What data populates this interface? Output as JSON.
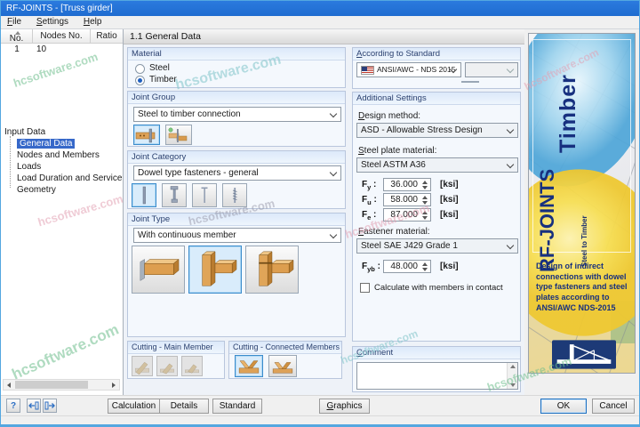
{
  "window": {
    "title": "RF-JOINTS - [Truss girder]"
  },
  "menu": {
    "items": [
      "File",
      "Settings",
      "Help"
    ]
  },
  "results_table": {
    "columns": [
      "No.",
      "Nodes No.",
      "Ratio"
    ],
    "rows": [
      {
        "no": "1",
        "nodes": "10",
        "ratio": ""
      }
    ]
  },
  "nav_tree": {
    "root": "Input Data",
    "items": [
      {
        "label": "General Data",
        "selected": true
      },
      {
        "label": "Nodes and Members",
        "selected": false
      },
      {
        "label": "Loads",
        "selected": false
      },
      {
        "label": "Load Duration and Service Con",
        "selected": false
      },
      {
        "label": "Geometry",
        "selected": false
      }
    ]
  },
  "section": {
    "title": "1.1 General Data"
  },
  "material": {
    "label": "Material",
    "steel": "Steel",
    "timber": "Timber",
    "selected": "Timber"
  },
  "joint_group": {
    "label": "Joint Group",
    "value": "Steel to timber connection"
  },
  "joint_category": {
    "label": "Joint Category",
    "value": "Dowel type fasteners - general"
  },
  "joint_type": {
    "label": "Joint Type",
    "value": "With continuous member"
  },
  "cutting_main": {
    "label": "Cutting - Main Member"
  },
  "cutting_connected": {
    "label": "Cutting - Connected Members"
  },
  "standard": {
    "label": "According to Standard",
    "value": "ANSI/AWC - NDS 2015",
    "secondary_value": ""
  },
  "settings": {
    "label": "Additional Settings",
    "colon": " :",
    "design_method_label": "Design method:",
    "design_method": "ASD - Allowable Stress Design",
    "steel_plate_label": "Steel plate material:",
    "steel_plate": "Steel ASTM A36",
    "fy": {
      "sym": "F",
      "sub": "y",
      "value": "36.000",
      "unit": "[ksi]"
    },
    "fu": {
      "sym": "F",
      "sub": "u",
      "value": "58.000",
      "unit": "[ksi]"
    },
    "fe": {
      "sym": "F",
      "sub": "e",
      "value": "87.000",
      "unit": "[ksi]"
    },
    "fastener_label": "Fastener material:",
    "fastener": "Steel SAE J429 Grade 1",
    "fyb": {
      "sym": "F",
      "sub": "yb",
      "value": "48.000",
      "unit": "[ksi]"
    },
    "contact_checkbox": "Calculate with members in contact"
  },
  "comment": {
    "label": "Comment",
    "value": ""
  },
  "brand": {
    "timber": "Timber",
    "product": "RF-JOINTS",
    "subtitle": "Steel to Timber",
    "description": "Design of indirect connections with dowel type fasteners and steel plates according to ANSI/AWC NDS-2015"
  },
  "footer": {
    "calculation": "Calculation",
    "details": "Details",
    "standard": "Standard",
    "graphics": "Graphics",
    "ok": "OK",
    "cancel": "Cancel",
    "help_icon": "?"
  },
  "watermark": {
    "text": "hcsoftware.com"
  },
  "colors": {
    "titlebar": "#2172d7",
    "accent": "#0078d7",
    "selection": "#3668c9",
    "group_title": "#2c4270",
    "brand_navy": "#17307f",
    "brand_yellow": "#f2cf2e",
    "brand_blue": "#4fa6d8"
  }
}
